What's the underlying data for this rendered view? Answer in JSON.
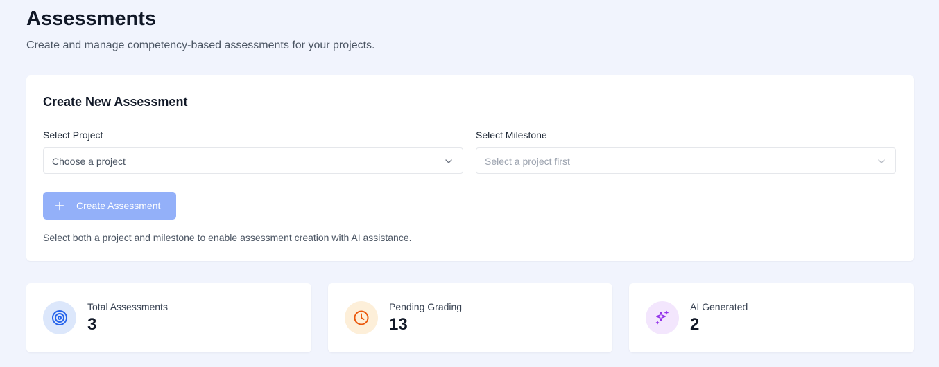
{
  "header": {
    "title": "Assessments",
    "subtitle": "Create and manage competency-based assessments for your projects."
  },
  "create_card": {
    "title": "Create New Assessment",
    "project_field": {
      "label": "Select Project",
      "value": "Choose a project",
      "icon": "chevron-down-icon"
    },
    "milestone_field": {
      "label": "Select Milestone",
      "value": "Select a project first",
      "disabled": true,
      "icon": "chevron-down-icon"
    },
    "create_button": {
      "label": "Create Assessment",
      "icon": "plus-icon",
      "disabled": true
    },
    "help_text": "Select both a project and milestone to enable assessment creation with AI assistance."
  },
  "stats": [
    {
      "label": "Total Assessments",
      "value": "3",
      "icon": "target-icon",
      "icon_color": "#2563eb",
      "icon_bg": "#dce7fb"
    },
    {
      "label": "Pending Grading",
      "value": "13",
      "icon": "clock-icon",
      "icon_color": "#ea580c",
      "icon_bg": "#fdefd9"
    },
    {
      "label": "AI Generated",
      "value": "2",
      "icon": "sparkles-icon",
      "icon_color": "#9333ea",
      "icon_bg": "#f3e6fd"
    }
  ],
  "colors": {
    "page_background": "#f1f4fd",
    "button_disabled": "#93b0f9"
  }
}
